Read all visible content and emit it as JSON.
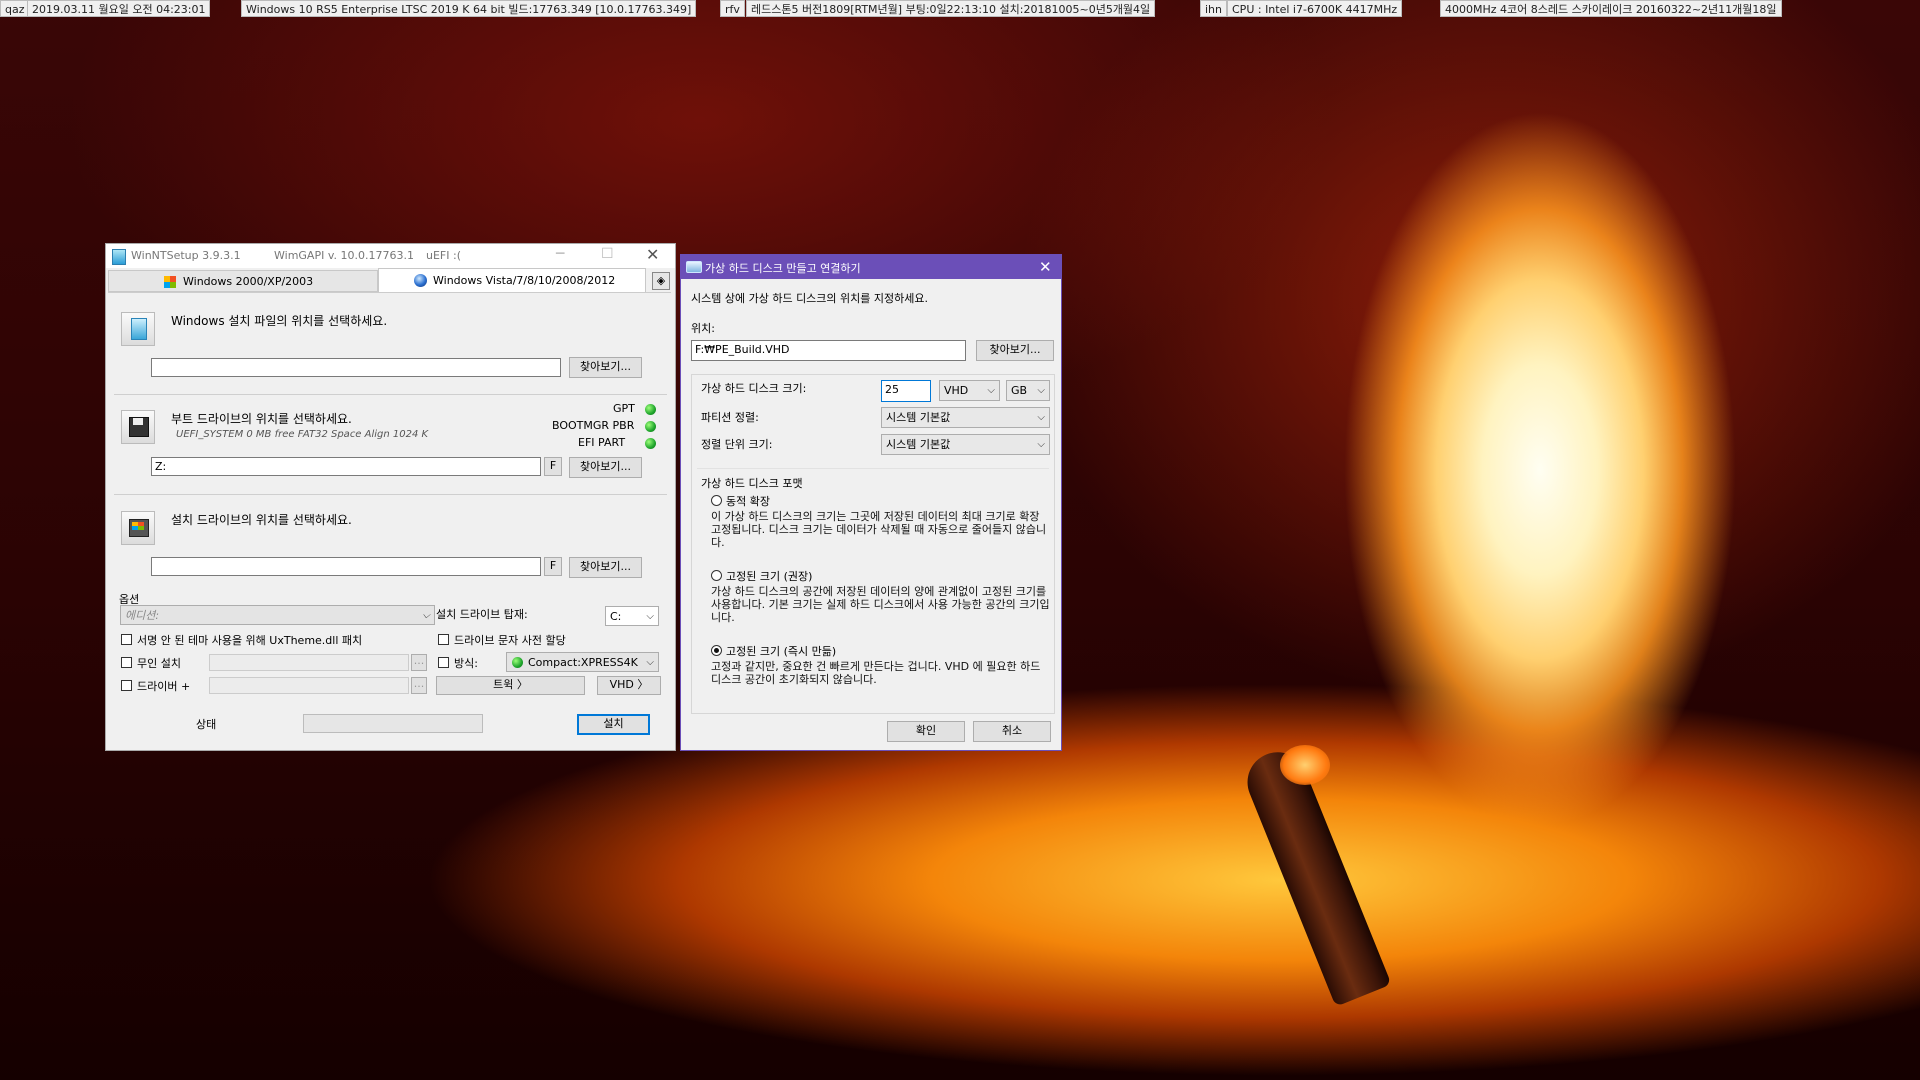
{
  "topbar": {
    "items": [
      "qaz",
      "2019.03.11 월요일 오전 04:23:01",
      "Windows 10 RS5 Enterprise LTSC 2019 K 64 bit 빌드:17763.349 [10.0.17763.349]",
      "rfv",
      "레드스톤5 버전1809[RTM년월] 부팅:0일22:13:10 설치:20181005~0년5개월4일",
      "ihn",
      "CPU : Intel i7-6700K 4417MHz",
      "4000MHz 4코어 8스레드 스카이레이크 20160322~2년11개월18일"
    ]
  },
  "winntsetup": {
    "title": "WinNTSetup 3.9.3.1",
    "wimgapi": "WimGAPI v. 10.0.17763.1",
    "uefi": "uEFI :(",
    "tabs": [
      "Windows 2000/XP/2003",
      "Windows Vista/7/8/10/2008/2012"
    ],
    "source_heading": "Windows 설치 파일의 위치를 선택하세요.",
    "source_value": "",
    "browse": "찾아보기...",
    "boot_heading": "부트 드라이브의 위치를 선택하세요.",
    "boot_info": "UEFI_SYSTEM 0 MB free FAT32 Space Align 1024 K",
    "boot_value": "Z:",
    "f_label": "F",
    "gpt": "GPT",
    "bootmgr": "BOOTMGR PBR",
    "efi_part": "EFI PART",
    "install_heading": "설치 드라이브의 위치를 선택하세요.",
    "install_value": "",
    "options_label": "옵션",
    "edition_placeholder": "에디션:",
    "install_drive_mount": "설치 드라이브 탑재:",
    "drive_letter": "C:",
    "uxtheme": "서명 안 된 테마 사용을 위해 UxTheme.dll 패치",
    "preassign": "드라이브 문자 사전 할당",
    "unattended": "무인 설치",
    "mode": "방식:",
    "compact": "Compact:XPRESS4K",
    "drivers": "드라이버 +",
    "tweaks": "트윅 〉",
    "vhd": "VHD 〉",
    "status": "상태",
    "install": "설치",
    "ellipsis": "..."
  },
  "vhd_dialog": {
    "title": "가상 하드 디스크 만들고 연결하기",
    "intro": "시스템 상에 가상 하드 디스크의 위치를 지정하세요.",
    "location_label": "위치:",
    "location_value": "F:₩PE_Build.VHD",
    "browse": "찾아보기...",
    "size_label": "가상 하드 디스크 크기:",
    "size_value": "25",
    "type": "VHD",
    "unit": "GB",
    "partition_label": "파티션 정렬:",
    "partition_value": "시스템 기본값",
    "cluster_label": "정렬 단위 크기:",
    "cluster_value": "시스템 기본값",
    "format_group": "가상 하드 디스크 포맷",
    "dynamic_label": "동적 확장",
    "dynamic_desc": "이 가상 하드 디스크의 크기는 그곳에 저장된 데이터의 최대 크기로 확장 고정됩니다. 디스크 크기는 데이터가 삭제될 때 자동으로 줄어들지 않습니다.",
    "fixed_label": "고정된 크기 (권장)",
    "fixed_desc": "가상 하드 디스크의 공간에 저장된 데이터의 양에 관계없이 고정된 크기를 사용합니다. 기본 크기는 실제 하드 디스크에서 사용 가능한 공간의 크기입니다.",
    "fast_label": "고정된 크기 (즉시 만듦)",
    "fast_desc": "고정과 같지만, 중요한 건 빠르게 만든다는 겁니다. VHD 에 필요한 하드 디스크 공간이 초기화되지 않습니다.",
    "ok": "확인",
    "cancel": "취소",
    "selected_format": "fast"
  },
  "colors": {
    "dialog_title_bg": "#6b4fb8",
    "accent": "#0078d7",
    "status_green": "#1fa52c"
  }
}
